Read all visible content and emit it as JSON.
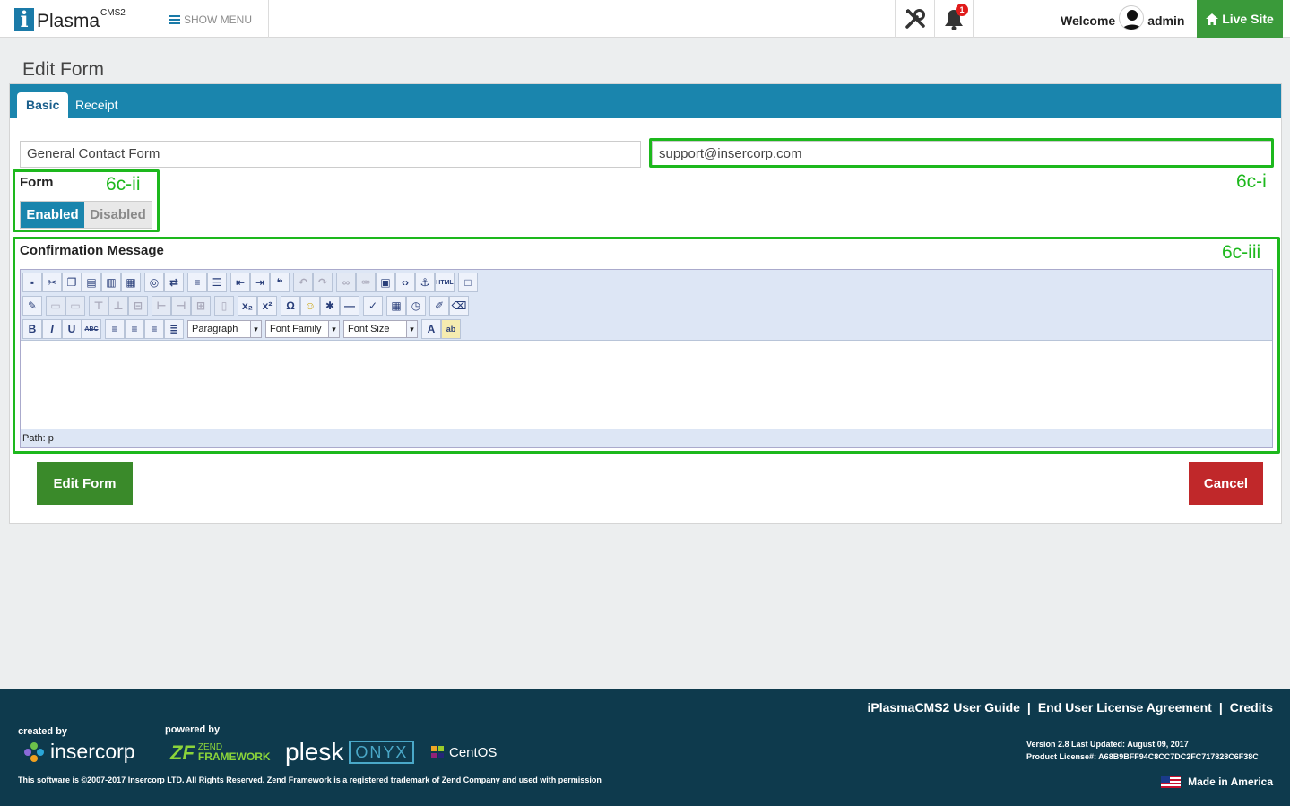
{
  "header": {
    "logo_letter": "i",
    "logo_text": "Plasma",
    "logo_sup": "CMS2",
    "show_menu": "SHOW MENU",
    "notification_count": "1",
    "welcome": "Welcome",
    "username": "admin",
    "live_site": "Live Site"
  },
  "page_title": "Edit Form",
  "tabs": [
    {
      "label": "Basic"
    },
    {
      "label": "Receipt"
    }
  ],
  "form": {
    "name_value": "General Contact Form",
    "email_value": "support@insercorp.com",
    "form_label": "Form",
    "enabled_label": "Enabled",
    "disabled_label": "Disabled",
    "confirmation_label": "Confirmation Message",
    "editor": {
      "format_select": "Paragraph",
      "font_family_select": "Font Family",
      "font_size_select": "Font Size",
      "path": "Path: p"
    },
    "submit_label": "Edit Form",
    "cancel_label": "Cancel"
  },
  "annotations": {
    "note_i": "6c-i",
    "note_ii": "6c-ii",
    "note_iii": "6c-iii",
    "color": "#1db81d"
  },
  "footer": {
    "links": [
      "iPlasmaCMS2 User Guide",
      "|",
      "End User License Agreement",
      "|",
      "Credits"
    ],
    "created_by": "created by",
    "insercorp": "insercorp",
    "powered_by": "powered by",
    "zend_mark": "ZF",
    "zend_line1": "ZEND",
    "zend_line2": "FRAMEWORK",
    "plesk": "plesk",
    "onyx": "ONYX",
    "centos": "CentOS",
    "copyright": "This software is ©2007-2017 Insercorp LTD. All Rights Reserved. Zend Framework is a registered trademark of Zend Company and used with permission",
    "version": "Version 2.8 Last Updated: August 09, 2017",
    "license": "Product License#: A68B9BFF94C8CC7DC2FC717828C6F38C",
    "made_in": "Made in America"
  }
}
